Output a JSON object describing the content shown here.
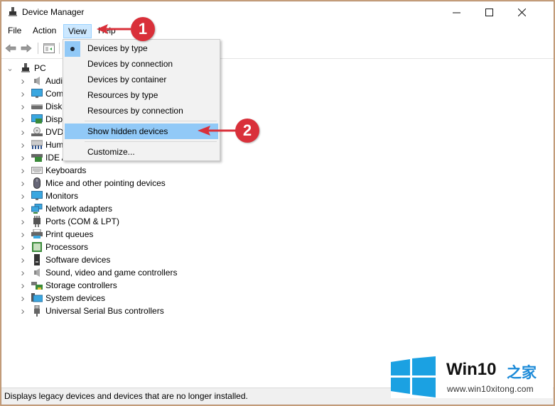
{
  "window": {
    "title": "Device Manager",
    "controls": {
      "minimize": "—",
      "maximize": "☐",
      "close": "✕"
    }
  },
  "menubar": {
    "items": [
      {
        "label": "File"
      },
      {
        "label": "Action"
      },
      {
        "label": "View",
        "active": true
      },
      {
        "label": "Help"
      }
    ]
  },
  "toolbar": {
    "buttons": [
      "back-arrow",
      "forward-arrow",
      "properties-panel"
    ]
  },
  "tree": {
    "root": {
      "label": "PC",
      "expanded": true
    },
    "items": [
      {
        "label": "Audio inputs and outputs",
        "icon": "speaker-icon"
      },
      {
        "label": "Computer",
        "icon": "computer-icon"
      },
      {
        "label": "Disk drives",
        "icon": "disk-drive-icon"
      },
      {
        "label": "Display adapters",
        "icon": "display-adapter-icon"
      },
      {
        "label": "DVD/CD-ROM drives",
        "icon": "dvd-drive-icon"
      },
      {
        "label": "Human Interface Devices",
        "icon": "hid-icon"
      },
      {
        "label": "IDE ATA/ATAPI controllers",
        "icon": "ide-controller-icon"
      },
      {
        "label": "Keyboards",
        "icon": "keyboard-icon"
      },
      {
        "label": "Mice and other pointing devices",
        "icon": "mouse-icon"
      },
      {
        "label": "Monitors",
        "icon": "monitor-icon"
      },
      {
        "label": "Network adapters",
        "icon": "network-adapter-icon"
      },
      {
        "label": "Ports (COM & LPT)",
        "icon": "port-icon"
      },
      {
        "label": "Print queues",
        "icon": "printer-icon"
      },
      {
        "label": "Processors",
        "icon": "processor-icon"
      },
      {
        "label": "Software devices",
        "icon": "software-device-icon"
      },
      {
        "label": "Sound, video and game controllers",
        "icon": "speaker-icon"
      },
      {
        "label": "Storage controllers",
        "icon": "storage-controller-icon"
      },
      {
        "label": "System devices",
        "icon": "system-device-icon"
      },
      {
        "label": "Universal Serial Bus controllers",
        "icon": "usb-icon"
      }
    ]
  },
  "view_menu": {
    "items": [
      {
        "label": "Devices by type",
        "checked": true
      },
      {
        "label": "Devices by connection"
      },
      {
        "label": "Devices by container"
      },
      {
        "label": "Resources by type"
      },
      {
        "label": "Resources by connection"
      },
      {
        "label": "Show hidden devices",
        "highlighted": true
      },
      {
        "label": "Customize..."
      }
    ]
  },
  "annotations": {
    "callout_1": "1",
    "callout_2": "2",
    "color": "#d9303a"
  },
  "statusbar": {
    "text": "Displays legacy devices and devices that are no longer installed."
  },
  "watermark": {
    "title": "Win10",
    "chinese": "之家",
    "url": "www.win10xitong.com",
    "logo_color": "#1ba1e2"
  }
}
